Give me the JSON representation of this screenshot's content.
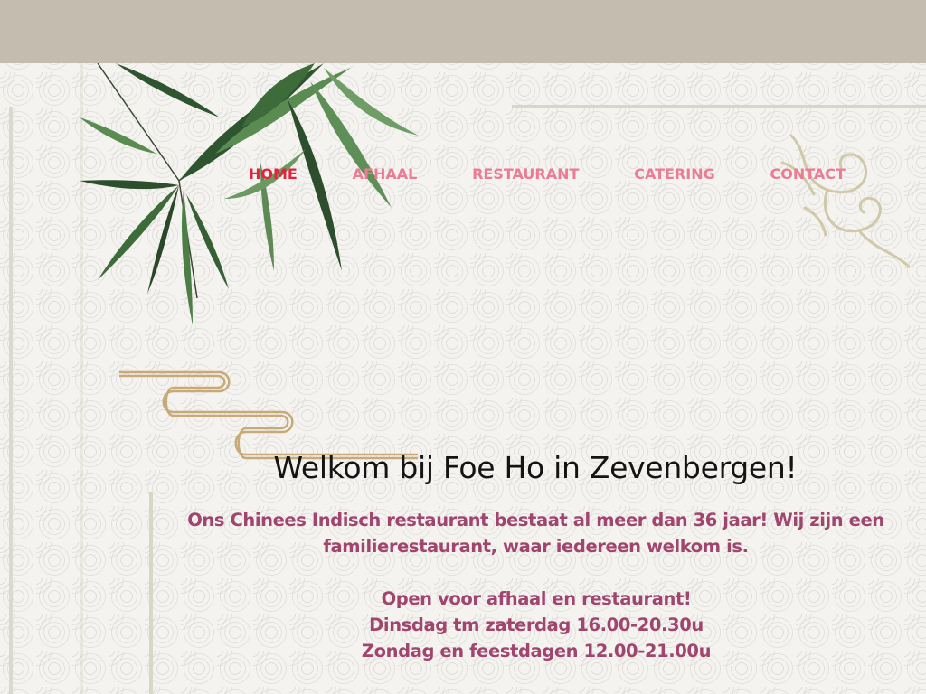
{
  "nav": {
    "items": [
      {
        "label": "HOME",
        "active": true
      },
      {
        "label": "AFHAAL",
        "active": false
      },
      {
        "label": "RESTAURANT",
        "active": false
      },
      {
        "label": "CATERING",
        "active": false
      },
      {
        "label": "CONTACT",
        "active": false
      }
    ]
  },
  "colors": {
    "top_bar": "#c5bcb0",
    "nav_link": "#ec7b94",
    "nav_active": "#e0243c",
    "body_text": "#a0456e",
    "title_text": "#141414"
  },
  "main": {
    "title": "Welkom bij Foe Ho in Zevenbergen!",
    "intro": "Ons Chinees Indisch restaurant bestaat al meer dan 36 jaar! Wij zijn een familierestaurant, waar iedereen welkom is.",
    "hours": {
      "line1": "Open voor afhaal en restaurant!",
      "line2": "Dinsdag tm zaterdag 16.00-20.30u",
      "line3": "Zondag en feestdagen 12.00-21.00u"
    }
  }
}
